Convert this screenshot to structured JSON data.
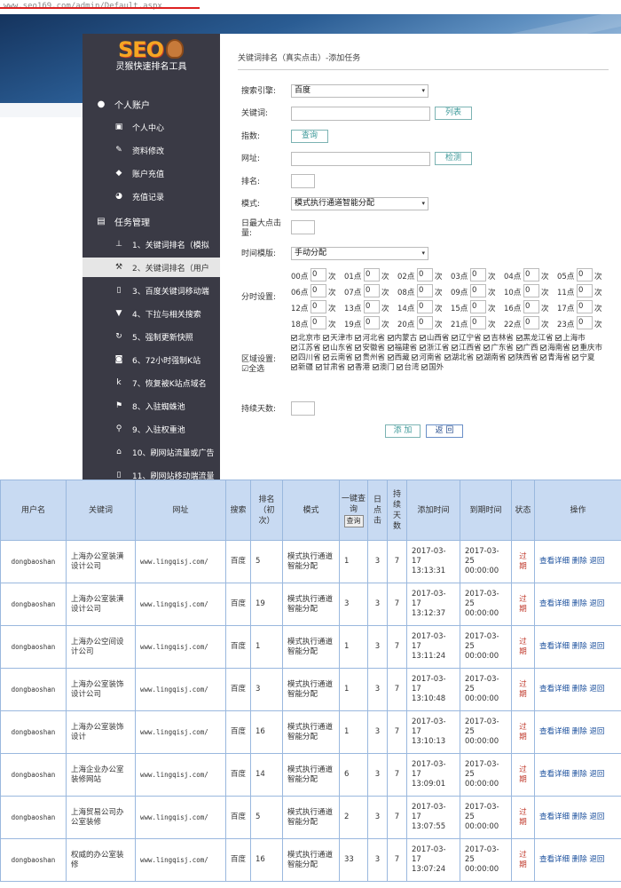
{
  "url": "www.seo169.com/admin/Default.aspx",
  "brand": {
    "logo_text": "SEO",
    "subtitle": "灵猴快速排名工具"
  },
  "sidebar": {
    "sections": [
      {
        "label": "个人账户",
        "icon": "user-icon"
      },
      {
        "label": "任务管理",
        "icon": "list-icon"
      }
    ],
    "account_items": [
      {
        "label": "个人中心",
        "icon": "id-card-icon"
      },
      {
        "label": "资料修改",
        "icon": "pencil-icon"
      },
      {
        "label": "账户充值",
        "icon": "tag-icon"
      },
      {
        "label": "充值记录",
        "icon": "pie-chart-icon"
      }
    ],
    "task_items": [
      {
        "label": "1、关键词排名（模拟",
        "icon": "stamp-icon"
      },
      {
        "label": "2、关键词排名（用户",
        "icon": "gavel-icon"
      },
      {
        "label": "3、百度关键词移动端",
        "icon": "mobile-icon"
      },
      {
        "label": "4、下拉与相关搜索",
        "icon": "caret-down-icon"
      },
      {
        "label": "5、强制更新快照",
        "icon": "refresh-icon"
      },
      {
        "label": "6、72小时强制K站",
        "icon": "k-box-icon"
      },
      {
        "label": "7、恢复被K站点域名",
        "icon": "k-icon"
      },
      {
        "label": "8、入驻蜘蛛池",
        "icon": "flag-icon"
      },
      {
        "label": "9、入驻权重池",
        "icon": "map-pin-icon"
      },
      {
        "label": "10、刷网站流量或广告",
        "icon": "home-icon"
      },
      {
        "label": "11、刷网站移动端流量",
        "icon": "mobile-home-icon"
      }
    ]
  },
  "form": {
    "breadcrumb": "关键词排名（真实点击）-添加任务",
    "engine_label": "搜索引擎:",
    "engine_value": "百度",
    "keyword_label": "关键词:",
    "keyword_btn": "列表",
    "index_label": "指数:",
    "index_btn": "查询",
    "url_label": "网址:",
    "url_btn": "检测",
    "rank_label": "排名:",
    "mode_label": "模式:",
    "mode_value": "模式执行通道智能分配",
    "daily_label": "日最大点击量:",
    "time_mode_label": "时间模版:",
    "time_mode_value": "手动分配",
    "hourly_label": "分时设置:",
    "count_unit": "次",
    "hours": [
      "00点",
      "01点",
      "02点",
      "03点",
      "04点",
      "05点",
      "06点",
      "07点",
      "08点",
      "09点",
      "10点",
      "11点",
      "12点",
      "13点",
      "14点",
      "15点",
      "16点",
      "17点",
      "18点",
      "19点",
      "20点",
      "21点",
      "22点",
      "23点"
    ],
    "hour_values": [
      "0",
      "0",
      "0",
      "0",
      "0",
      "0",
      "0",
      "0",
      "0",
      "0",
      "0",
      "0",
      "0",
      "0",
      "0",
      "0",
      "0",
      "0",
      "0",
      "0",
      "0",
      "0",
      "0",
      "0"
    ],
    "region_label": "区域设置:",
    "region_all": "全选",
    "regions": [
      "北京市",
      "天津市",
      "河北省",
      "内蒙古",
      "山西省",
      "辽宁省",
      "吉林省",
      "黑龙江省",
      "上海市",
      "江苏省",
      "山东省",
      "安徽省",
      "福建省",
      "浙江省",
      "江西省",
      "广东省",
      "广西",
      "海南省",
      "重庆市",
      "四川省",
      "云南省",
      "贵州省",
      "西藏",
      "河南省",
      "湖北省",
      "湖南省",
      "陕西省",
      "青海省",
      "宁夏",
      "新疆",
      "甘肃省",
      "香港",
      "澳门",
      "台湾",
      "国外"
    ],
    "days_label": "持续天数:",
    "add_btn": "添 加",
    "back_btn": "返 回"
  },
  "table": {
    "headers": [
      "用户名",
      "关键词",
      "网址",
      "搜索",
      "排名（初次）",
      "模式",
      "一键查询",
      "日点击",
      "持续天数",
      "添加时间",
      "到期时间",
      "状态",
      "操作"
    ],
    "query_btn": "查询",
    "rows": [
      {
        "user": "dongbaoshan",
        "keyword": "上海办公室装潢设计公司",
        "url": "www.lingqisj.com/",
        "engine": "百度",
        "rank": "5",
        "mode": "模式执行通道智能分配",
        "query": "1",
        "clicks": "3",
        "days": "7",
        "added": "2017-03-17 13:13:31",
        "expires": "2017-03-25 00:00:00",
        "status": "过期",
        "ops": "查看详细 删除 退回"
      },
      {
        "user": "dongbaoshan",
        "keyword": "上海办公室装潢设计公司",
        "url": "www.lingqisj.com/",
        "engine": "百度",
        "rank": "19",
        "mode": "模式执行通道智能分配",
        "query": "3",
        "clicks": "3",
        "days": "7",
        "added": "2017-03-17 13:12:37",
        "expires": "2017-03-25 00:00:00",
        "status": "过期",
        "ops": "查看详细 删除 退回"
      },
      {
        "user": "dongbaoshan",
        "keyword": "上海办公空间设计公司",
        "url": "www.lingqisj.com/",
        "engine": "百度",
        "rank": "1",
        "mode": "模式执行通道智能分配",
        "query": "1",
        "clicks": "3",
        "days": "7",
        "added": "2017-03-17 13:11:24",
        "expires": "2017-03-25 00:00:00",
        "status": "过期",
        "ops": "查看详细 删除 退回"
      },
      {
        "user": "dongbaoshan",
        "keyword": "上海办公室装饰设计公司",
        "url": "www.lingqisj.com/",
        "engine": "百度",
        "rank": "3",
        "mode": "模式执行通道智能分配",
        "query": "1",
        "clicks": "3",
        "days": "7",
        "added": "2017-03-17 13:10:48",
        "expires": "2017-03-25 00:00:00",
        "status": "过期",
        "ops": "查看详细 删除 退回"
      },
      {
        "user": "dongbaoshan",
        "keyword": "上海办公室装饰设计",
        "url": "www.lingqisj.com/",
        "engine": "百度",
        "rank": "16",
        "mode": "模式执行通道智能分配",
        "query": "1",
        "clicks": "3",
        "days": "7",
        "added": "2017-03-17 13:10:13",
        "expires": "2017-03-25 00:00:00",
        "status": "过期",
        "ops": "查看详细 删除 退回"
      },
      {
        "user": "dongbaoshan",
        "keyword": "上海企业办公室装修网站",
        "url": "www.lingqisj.com/",
        "engine": "百度",
        "rank": "14",
        "mode": "模式执行通道智能分配",
        "query": "6",
        "clicks": "3",
        "days": "7",
        "added": "2017-03-17 13:09:01",
        "expires": "2017-03-25 00:00:00",
        "status": "过期",
        "ops": "查看详细 删除 退回"
      },
      {
        "user": "dongbaoshan",
        "keyword": "上海贸易公司办公室装修",
        "url": "www.lingqisj.com/",
        "engine": "百度",
        "rank": "5",
        "mode": "模式执行通道智能分配",
        "query": "2",
        "clicks": "3",
        "days": "7",
        "added": "2017-03-17 13:07:55",
        "expires": "2017-03-25 00:00:00",
        "status": "过期",
        "ops": "查看详细 删除 退回"
      },
      {
        "user": "dongbaoshan",
        "keyword": "权威的办公室装修",
        "url": "www.lingqisj.com/",
        "engine": "百度",
        "rank": "16",
        "mode": "模式执行通道智能分配",
        "query": "33",
        "clicks": "3",
        "days": "7",
        "added": "2017-03-17 13:07:24",
        "expires": "2017-03-25 00:00:00",
        "status": "过期",
        "ops": "查看详细 删除 退回"
      }
    ]
  },
  "colors": {
    "sidebar_bg": "#3a3a45",
    "accent_teal": "#3c9999",
    "table_header": "#c8daf2",
    "status_red": "#c0392b",
    "link_blue": "#1a4f9c"
  }
}
